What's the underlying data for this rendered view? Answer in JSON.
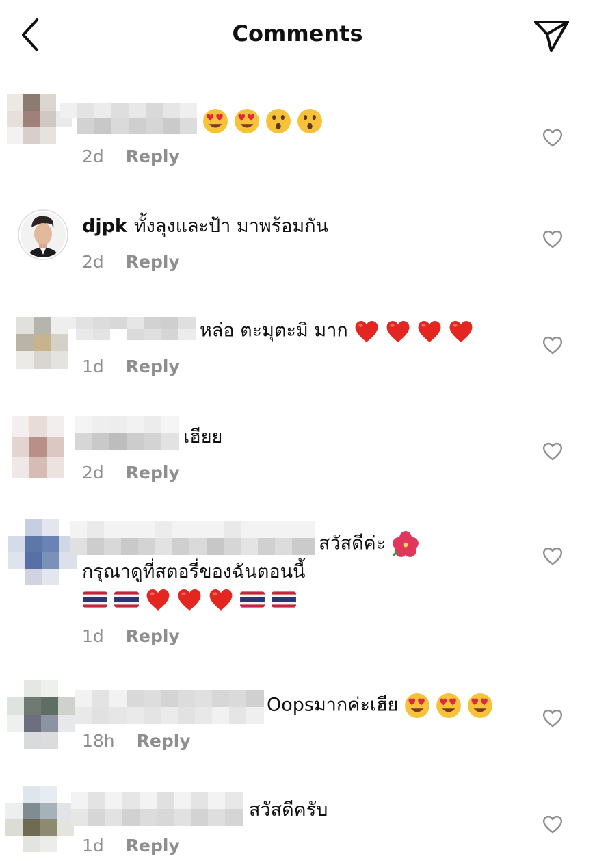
{
  "header": {
    "title": "Comments",
    "back_icon": "chevron-left-icon",
    "share_icon": "send-icon"
  },
  "colors": {
    "heart_outline": "#8e8e8e",
    "meta_text": "#8e8e8e",
    "divider": "#e0e0e0"
  },
  "comments": [
    {
      "text": "",
      "emojis": [
        "heart-eyes-face",
        "heart-eyes-face",
        "astonished-face",
        "astonished-face"
      ],
      "time": "2d",
      "reply": "Reply"
    },
    {
      "username": "djpk",
      "text": "ทั้งลุงและป้า มาพร้อมกัน",
      "time": "2d",
      "reply": "Reply"
    },
    {
      "text": "หล่อ ตะมุตะมิ มาก",
      "emojis": [
        "red-heart",
        "red-heart",
        "red-heart",
        "red-heart"
      ],
      "time": "1d",
      "reply": "Reply"
    },
    {
      "text": "เฮียย",
      "time": "2d",
      "reply": "Reply"
    },
    {
      "text": "สวัสดีค่ะ",
      "line2": "กรุณาดูที่สตอรี่ของฉันตอนนี้",
      "emojis": [
        "hibiscus",
        "thailand-flag",
        "thailand-flag",
        "red-heart",
        "red-heart",
        "red-heart",
        "thailand-flag",
        "thailand-flag"
      ],
      "time": "1d",
      "reply": "Reply"
    },
    {
      "text": "Oopsมากค่ะเฮีย",
      "emojis": [
        "heart-eyes-face",
        "heart-eyes-face",
        "heart-eyes-face"
      ],
      "time": "18h",
      "reply": "Reply"
    },
    {
      "text": "สวัสดีครับ",
      "time": "1d",
      "reply": "Reply"
    }
  ]
}
